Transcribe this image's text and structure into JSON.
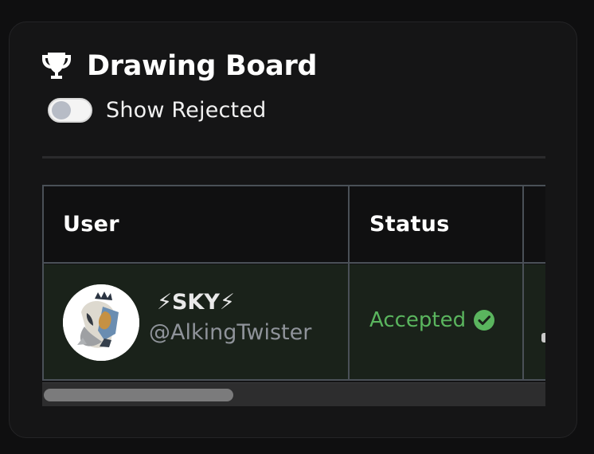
{
  "board": {
    "title": "Drawing Board",
    "icon": "trophy-icon"
  },
  "filters": {
    "show_rejected_label": "Show Rejected",
    "show_rejected_enabled": false
  },
  "table": {
    "columns": [
      "User",
      "Status"
    ],
    "rows": [
      {
        "display_name": "⚡SKY⚡",
        "handle": "@AlkingTwister",
        "status": "Accepted",
        "status_icon": "check-circle-icon"
      }
    ]
  },
  "colors": {
    "accepted": "#5ab55e",
    "accepted_row_background": "#1a221a"
  }
}
